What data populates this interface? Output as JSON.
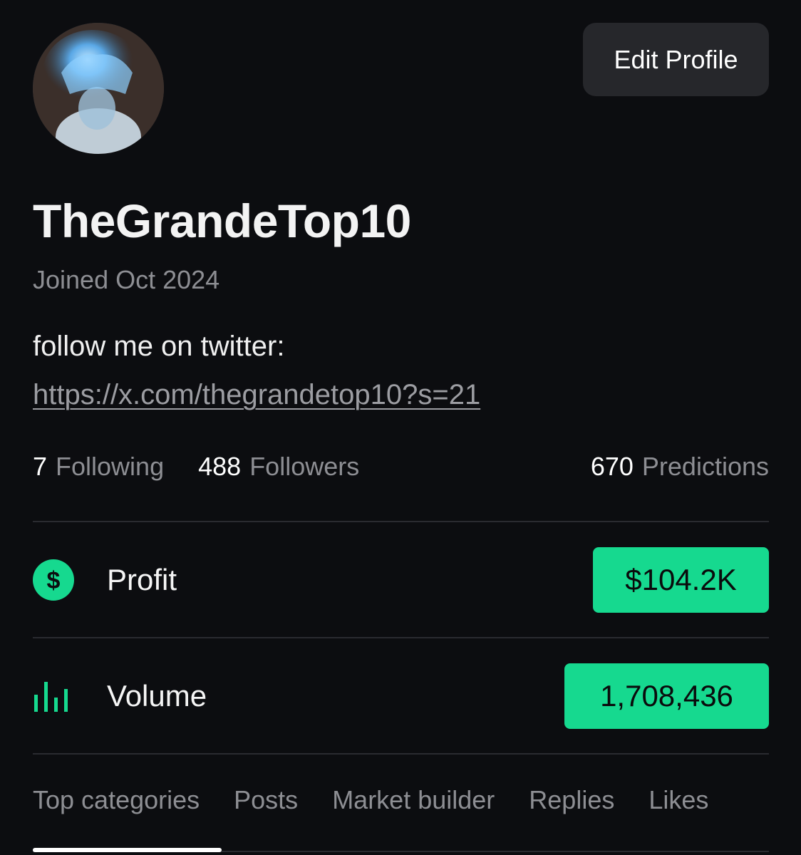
{
  "profile": {
    "avatar_icon": "profile-avatar",
    "edit_button_label": "Edit Profile",
    "username": "TheGrandeTop10",
    "joined": "Joined Oct 2024",
    "bio_text": "follow me on twitter: ",
    "bio_link": "https://x.com/thegrandetop10?s=21"
  },
  "stats": {
    "following_count": "7",
    "following_label": "Following",
    "followers_count": "488",
    "followers_label": "Followers",
    "predictions_count": "670",
    "predictions_label": "Predictions"
  },
  "metrics": {
    "profit": {
      "icon": "dollar-icon",
      "label": "Profit",
      "value": "$104.2K"
    },
    "volume": {
      "icon": "bar-chart-icon",
      "label": "Volume",
      "value": "1,708,436"
    }
  },
  "tabs": [
    {
      "label": "Top categories",
      "active": true
    },
    {
      "label": "Posts",
      "active": false
    },
    {
      "label": "Market builder",
      "active": false
    },
    {
      "label": "Replies",
      "active": false
    },
    {
      "label": "Likes",
      "active": false
    }
  ],
  "colors": {
    "background": "#0c0d10",
    "accent_green": "#16d98f",
    "muted_text": "#8d8e93",
    "button_bg": "#26272b"
  }
}
